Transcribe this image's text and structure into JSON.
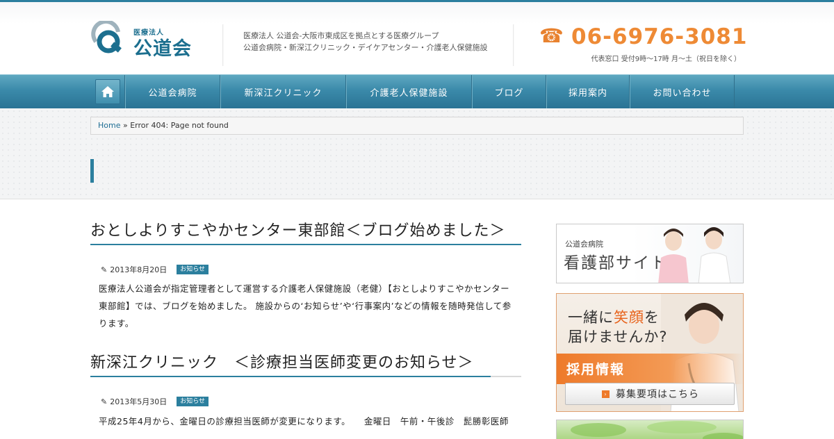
{
  "header": {
    "logo_small": "医療法人",
    "logo_big": "公道会",
    "tagline_line1": "医療法人 公道会-大阪市東成区を拠点とする医療グループ",
    "tagline_line2": "公道会病院・新深江クリニック・デイケアセンター・介護老人保健施設",
    "phone_icon": "☎",
    "phone_number": "06-6976-3081",
    "hours": "代表窓口 受付9時〜17時 月〜土（祝日を除く）"
  },
  "nav": {
    "home_icon": "home-icon",
    "items": [
      {
        "label": "公道会病院"
      },
      {
        "label": "新深江クリニック"
      },
      {
        "label": "介護老人保健施設"
      },
      {
        "label": "ブログ"
      },
      {
        "label": "採用案内"
      },
      {
        "label": "お問い合わせ"
      }
    ]
  },
  "breadcrumb": {
    "home": "Home",
    "separator": "»",
    "current": "Error 404: Page not found"
  },
  "posts": [
    {
      "title": "おとしよりすこやかセンター東部館＜ブログ始めました＞",
      "date": "2013年8月20日",
      "category": "お知らせ",
      "excerpt": "医療法人公道会が指定管理者として運営する介護老人保健施設（老健）【おとしよりすこやかセンター東部館】では、ブログを始めました。 施設からの‘お知らせ’や‘行事案内’などの情報を随時発信して参ります。"
    },
    {
      "title": "新深江クリニック　＜診療担当医師変更のお知らせ＞",
      "date": "2013年5月30日",
      "category": "お知らせ",
      "excerpt": "平成25年4月から、金曜日の診療担当医師が変更になります。　　金曜日　午前・午後診　髭勝彰医師"
    }
  ],
  "sidebar": {
    "banner1_small": "公道会病院",
    "banner1_big": "看護部サイト",
    "banner2_prefix": "一緒に",
    "banner2_highlight": "笑顔",
    "banner2_suffix": "を",
    "banner2_line2": "届けませんか?",
    "banner2_recruit": "採用情報",
    "banner2_button": "募集要項はこちら",
    "banner2_arrow": "›"
  },
  "colors": {
    "accent_blue": "#2b7f9e",
    "accent_orange": "#ee8a35",
    "badge_bg": "#2b7f9e"
  }
}
